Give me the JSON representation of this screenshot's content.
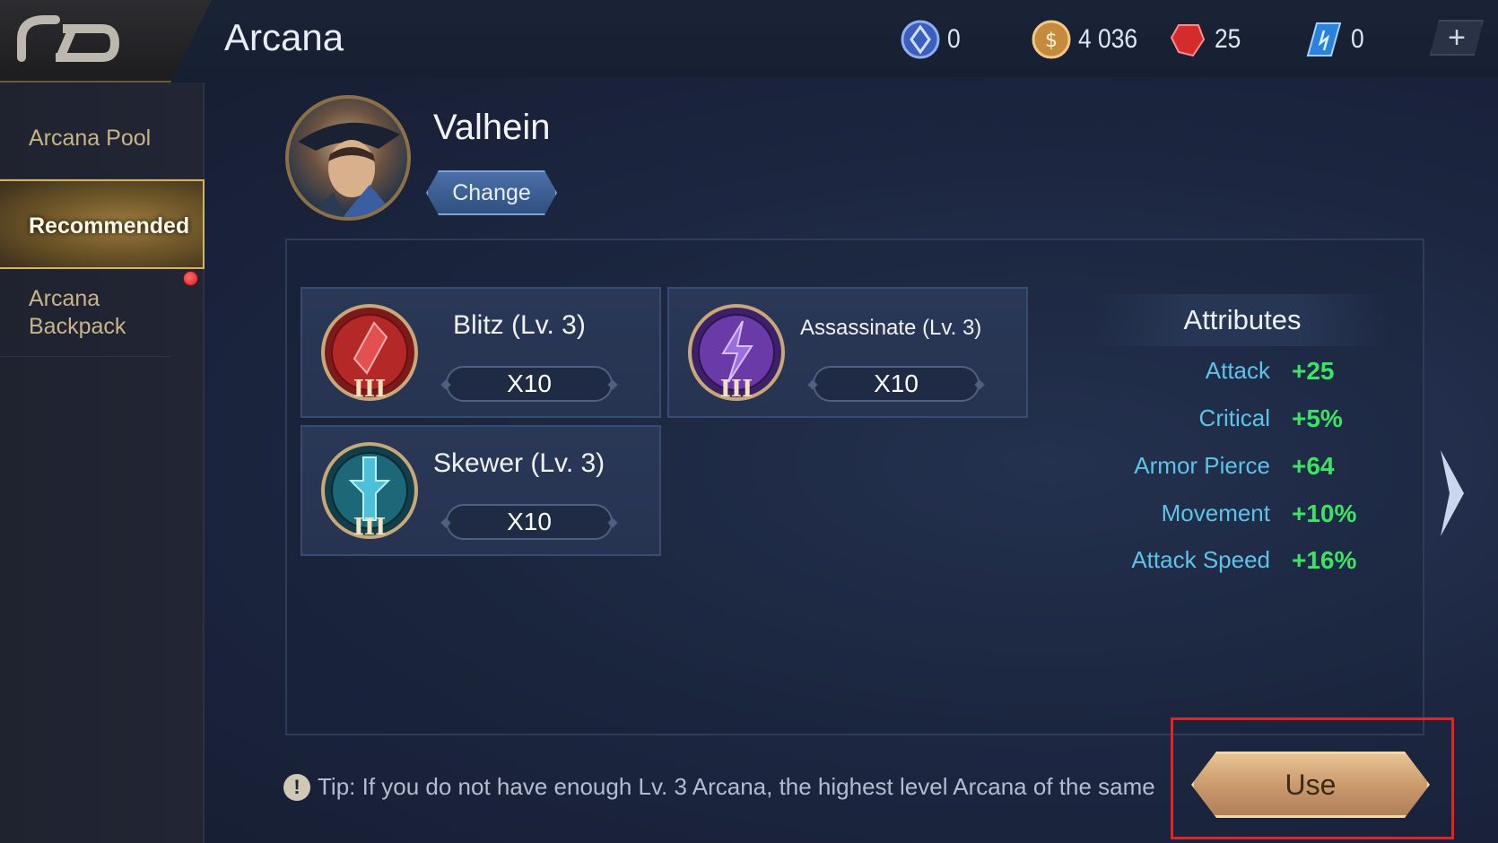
{
  "header": {
    "title": "Arcana",
    "back_icon": "back-arrow-icon",
    "currencies": [
      {
        "icon": "voucher-icon",
        "value": "0",
        "color": "#5a7fd8"
      },
      {
        "icon": "gold-coin-icon",
        "value": "4 036",
        "color": "#d39a4a"
      },
      {
        "icon": "ruby-icon",
        "value": "25",
        "color": "#d83434"
      },
      {
        "icon": "diamond-icon",
        "value": "0",
        "color": "#3a8ee0"
      }
    ],
    "add_label": "+"
  },
  "sidebar": {
    "items": [
      {
        "label": "Arcana Pool",
        "selected": false
      },
      {
        "label": "Recommended",
        "selected": true
      },
      {
        "label": "Arcana Backpack",
        "selected": false,
        "has_notification": true
      }
    ]
  },
  "hero": {
    "name": "Valhein",
    "change_label": "Change"
  },
  "arcana": [
    {
      "name": "Blitz (Lv. 3)",
      "count": "X10",
      "tier": "III",
      "color": "red"
    },
    {
      "name": "Assassinate (Lv. 3)",
      "count": "X10",
      "tier": "III",
      "color": "purple"
    },
    {
      "name": "Skewer (Lv. 3)",
      "count": "X10",
      "tier": "III",
      "color": "teal"
    }
  ],
  "attributes": {
    "title": "Attributes",
    "rows": [
      {
        "label": "Attack",
        "value": "+25"
      },
      {
        "label": "Critical",
        "value": "+5%"
      },
      {
        "label": "Armor Pierce",
        "value": "+64"
      },
      {
        "label": "Movement",
        "value": "+10%"
      },
      {
        "label": "Attack Speed",
        "value": "+16%"
      }
    ]
  },
  "footer": {
    "tip": "Tip: If you do not have enough Lv. 3 Arcana, the highest level Arcana of the same",
    "use_label": "Use"
  }
}
